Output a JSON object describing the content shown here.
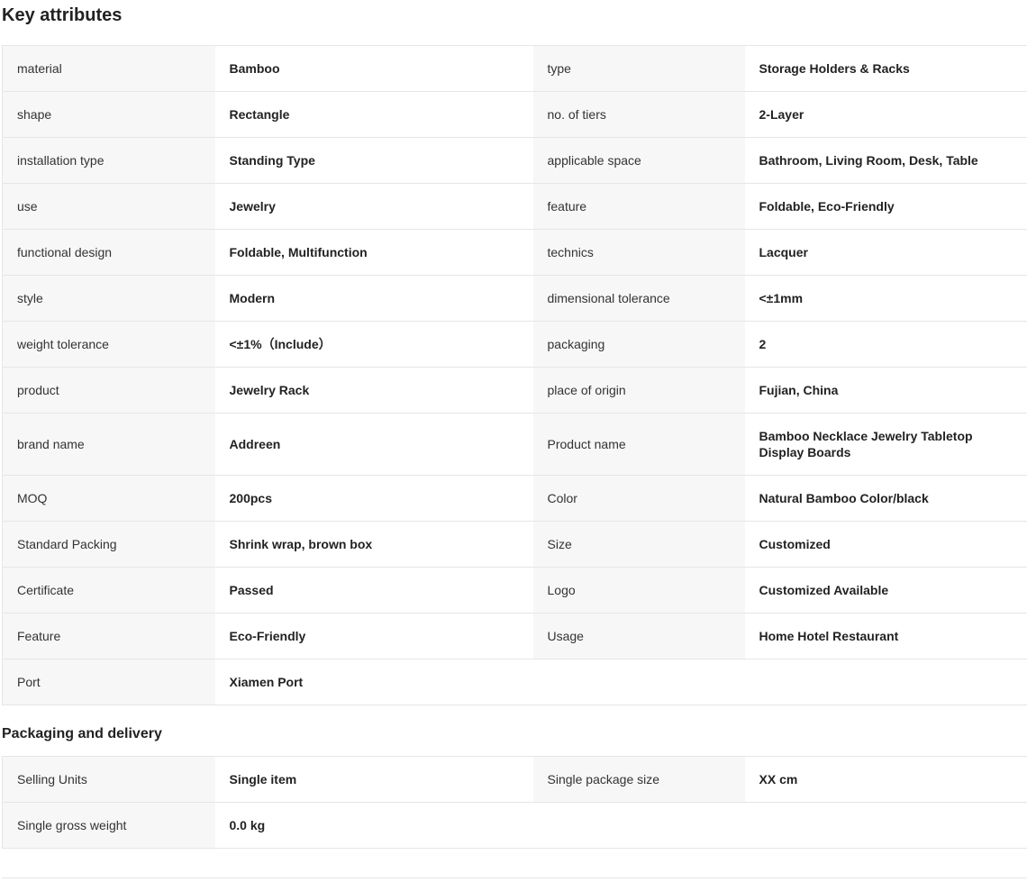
{
  "key_attributes": {
    "title": "Key attributes",
    "rows": [
      [
        "material",
        "Bamboo",
        "type",
        "Storage Holders & Racks"
      ],
      [
        "shape",
        "Rectangle",
        "no. of tiers",
        "2-Layer"
      ],
      [
        "installation type",
        "Standing Type",
        "applicable space",
        "Bathroom, Living Room, Desk, Table"
      ],
      [
        "use",
        "Jewelry",
        "feature",
        "Foldable, Eco-Friendly"
      ],
      [
        "functional design",
        "Foldable, Multifunction",
        "technics",
        "Lacquer"
      ],
      [
        "style",
        "Modern",
        "dimensional tolerance",
        "<±1mm"
      ],
      [
        "weight tolerance",
        "<±1%（Include）",
        "packaging",
        "2"
      ],
      [
        "product",
        "Jewelry Rack",
        "place of origin",
        "Fujian, China"
      ],
      [
        "brand name",
        "Addreen",
        "Product name",
        "Bamboo Necklace Jewelry Tabletop Display Boards"
      ],
      [
        "MOQ",
        "200pcs",
        "Color",
        "Natural Bamboo Color/black"
      ],
      [
        "Standard Packing",
        "Shrink wrap, brown box",
        "Size",
        "Customized"
      ],
      [
        "Certificate",
        "Passed",
        "Logo",
        "Customized Available"
      ],
      [
        "Feature",
        "Eco-Friendly",
        "Usage",
        "Home Hotel Restaurant"
      ],
      [
        "Port",
        "Xiamen Port",
        "",
        ""
      ]
    ]
  },
  "packaging_delivery": {
    "title": "Packaging and delivery",
    "rows": [
      [
        "Selling Units",
        "Single item",
        "Single package size",
        "XX cm"
      ],
      [
        "Single gross weight",
        "0.0 kg",
        "",
        ""
      ]
    ]
  },
  "colors": {
    "label_background": "#f7f7f7",
    "border": "#e6e6e6",
    "text": "#222222"
  }
}
